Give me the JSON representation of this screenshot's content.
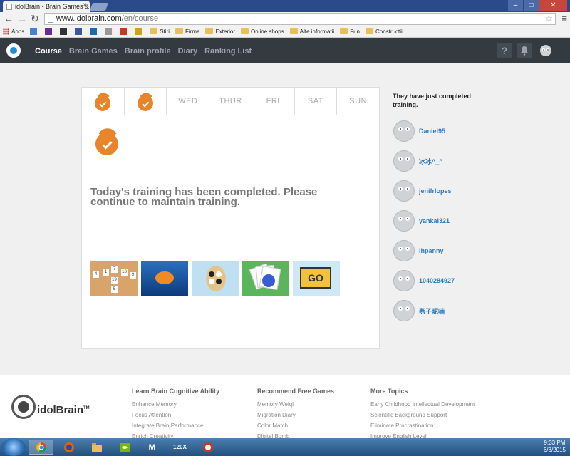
{
  "browser": {
    "tab_title": "idolBrain - Brain Games &",
    "tab_close": "×",
    "window_controls": [
      "–",
      "□",
      "✕"
    ],
    "url_host": "www.idolbrain.com",
    "url_path": "/en/course",
    "bookmarks": [
      {
        "label": "Apps",
        "type": "apps"
      },
      {
        "label": "",
        "type": "icon",
        "color": "#4a7ed6"
      },
      {
        "label": "",
        "type": "icon",
        "color": "#6b2c91"
      },
      {
        "label": "",
        "type": "icon",
        "color": "#333333"
      },
      {
        "label": "",
        "type": "icon",
        "color": "#3b5998"
      },
      {
        "label": "",
        "type": "icon",
        "color": "#1c6bb0"
      },
      {
        "label": "",
        "type": "icon",
        "color": "#999999"
      },
      {
        "label": "",
        "type": "icon",
        "color": "#c23c2a"
      },
      {
        "label": "",
        "type": "icon",
        "color": "#d0a020"
      },
      {
        "label": "Stiri",
        "type": "folder"
      },
      {
        "label": "Firme",
        "type": "folder"
      },
      {
        "label": "Exterior",
        "type": "folder"
      },
      {
        "label": "Online shops",
        "type": "folder"
      },
      {
        "label": "Alte informatii",
        "type": "folder"
      },
      {
        "label": "Fun",
        "type": "folder"
      },
      {
        "label": "Constructii",
        "type": "folder"
      }
    ]
  },
  "header": {
    "nav": [
      "Course",
      "Brain Games",
      "Brain profile",
      "Diary",
      "Ranking List"
    ],
    "help_icon": "?",
    "bell_icon": "bell-icon",
    "user_icon": "user-icon"
  },
  "week": {
    "days": [
      {
        "label": "",
        "done": true
      },
      {
        "label": "",
        "done": true
      },
      {
        "label": "WED",
        "done": false
      },
      {
        "label": "THUR",
        "done": false
      },
      {
        "label": "FRI",
        "done": false
      },
      {
        "label": "SAT",
        "done": false
      },
      {
        "label": "SUN",
        "done": false
      }
    ]
  },
  "main": {
    "done_message": "Today's training has been completed. Please continue to maintain training.",
    "game_sign": "GO"
  },
  "sidebar": {
    "title": "They have just completed training.",
    "users": [
      "Daniel95",
      "冰冰^_^",
      "jenifrlopes",
      "yankai321",
      "lhpanny",
      "1040284927",
      "燕子昵喃"
    ]
  },
  "footer": {
    "brand": "idolBrain",
    "tm": "TM",
    "columns": [
      {
        "title": "Learn Brain Cognitive Ability",
        "items": [
          "Enhance Memory",
          "Focus Attention",
          "Integrate Brain Performance",
          "Enrich Creativity"
        ]
      },
      {
        "title": "Recommend Free Games",
        "items": [
          "Memory Weiqi",
          "Migration Diary",
          "Color Match",
          "Digital Bomb"
        ]
      },
      {
        "title": "More Topics",
        "items": [
          "Early Childhood Intellectual Development",
          "Scientific Background Support",
          "Eliminate Procrastination",
          "Improve English Level"
        ]
      }
    ]
  },
  "taskbar": {
    "time": "9:33 PM",
    "date": "6/8/2015",
    "m_label": "M",
    "tv_label": "120X"
  },
  "colors": {
    "accent_orange": "#e8842a",
    "link_blue": "#2e7cc0",
    "header_bg": "#333a40"
  }
}
